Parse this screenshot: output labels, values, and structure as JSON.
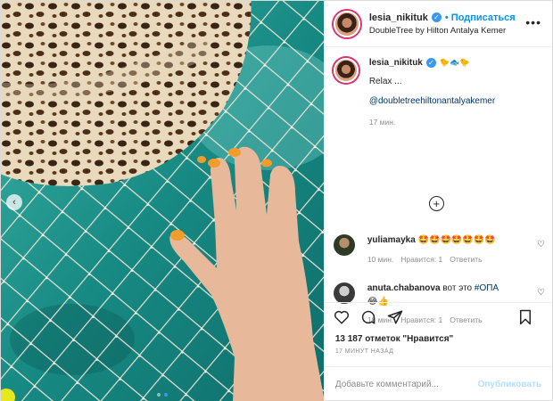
{
  "post": {
    "username": "lesia_nikituk",
    "follow_label": "• Подписаться",
    "location": "DoubleTree by Hilton Antalya Kemer",
    "more_icon": "more-dots-icon",
    "caption": {
      "emojis": "🐤🐟🐤",
      "text": "Relax ...",
      "mention": "@doubletreehiltonantalyakemer",
      "time": "17 мин."
    },
    "comments": [
      {
        "username": "yuliamayka",
        "text": "🤩🤩🤩🤩🤩🤩🤩",
        "time": "10 мин.",
        "likes": "Нравится: 1",
        "reply": "Ответить"
      },
      {
        "username": "anuta.chabanova",
        "text": " вот это ",
        "hashtag": "#ОПА",
        "emojis": "😂👍",
        "time": "10 мин.",
        "likes": "Нравится: 1",
        "reply": "Ответить"
      }
    ],
    "likes_count": "13 187 отметок \"Нравится\"",
    "time_ago": "17 МИНУТ НАЗАД",
    "add_comment_placeholder": "Добавьте комментарий...",
    "publish_label": "Опубликовать"
  },
  "colors": {
    "accent": "#0095f6",
    "verified": "#3897f0",
    "publish_disabled": "#b2dffc",
    "water": "#1f8f87"
  }
}
